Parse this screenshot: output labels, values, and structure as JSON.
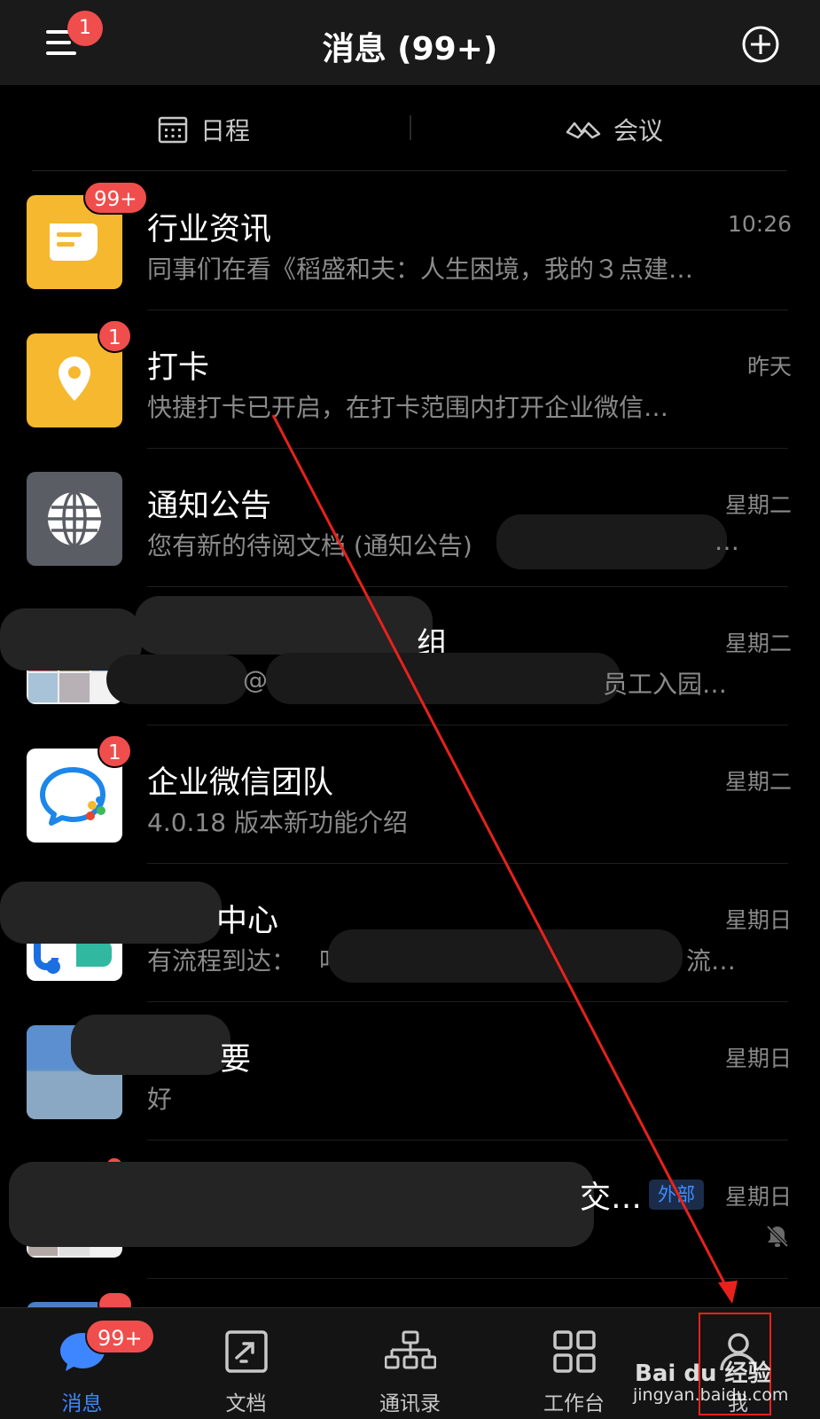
{
  "header": {
    "title": "消息 (99+)",
    "menu_badge": "1"
  },
  "tabs": {
    "schedule": "日程",
    "meeting": "会议"
  },
  "conversations": [
    {
      "name": "行业资讯",
      "preview": "同事们在看《稻盛和夫：人生困境，我的３点建…",
      "time": "10:26",
      "badge": "99+",
      "icon": "document-icon",
      "color": "#f5b82e"
    },
    {
      "name": "打卡",
      "preview": "快捷打卡已开启，在打卡范围内打开企业微信…",
      "time": "昨天",
      "badge": "1",
      "icon": "location-pin-icon",
      "color": "#f5b82e"
    },
    {
      "name": "通知公告",
      "preview": "您有新的待阅文档 (通知公告)",
      "preview_tail": "…",
      "time": "星期二",
      "icon": "globe-icon",
      "color": "#5a5d63"
    },
    {
      "name_tail": "组",
      "preview_mid": "@",
      "preview_tail": "员工入园…",
      "time": "星期二"
    },
    {
      "name": "企业微信团队",
      "preview": "4.0.18 版本新功能介绍",
      "time": "星期二",
      "badge": "1",
      "icon": "chat-bubble-icon",
      "color": "#ffffff"
    },
    {
      "name_tail": "中心",
      "preview": "有流程到达：",
      "preview_mid": "吖",
      "preview_tail": "流…",
      "time": "星期日"
    },
    {
      "name_tail": "要",
      "preview": "好",
      "time": "星期日"
    },
    {
      "name_tail": "交…",
      "tag": "外部",
      "time": "星期日",
      "muted": "bell-muted-icon"
    }
  ],
  "tabbar": {
    "items": [
      "消息",
      "文档",
      "通讯录",
      "工作台",
      "我"
    ],
    "messages_badge": "99+"
  },
  "watermark": {
    "brand": "Bai du 经验",
    "url": "jingyan.baidu.com"
  },
  "colors": {
    "accent": "#3e86ff",
    "badge": "#f04d4d",
    "annotation": "#e8221b"
  }
}
